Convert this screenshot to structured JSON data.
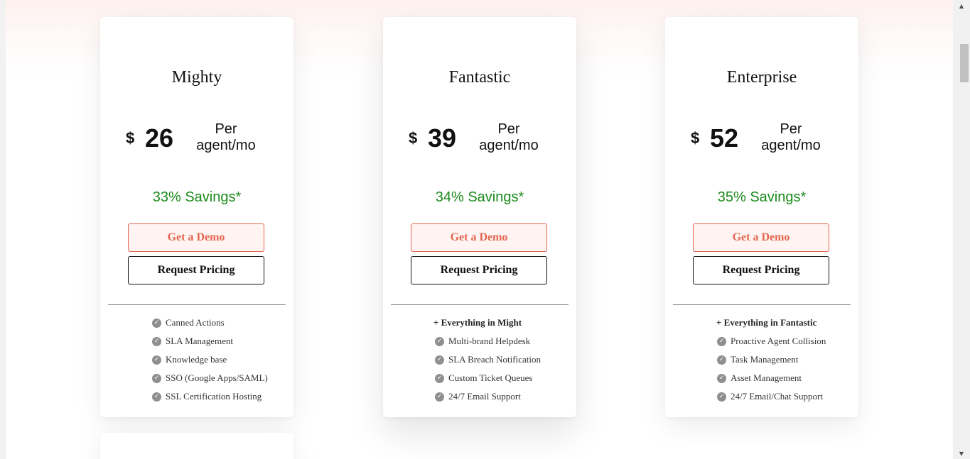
{
  "plans": [
    {
      "name": "Mighty",
      "currency": "$",
      "price": "26",
      "per_line1": "Per",
      "per_line2": "agent/mo",
      "savings": "33% Savings*",
      "demo_label": "Get a Demo",
      "pricing_label": "Request Pricing",
      "heading": "",
      "features": [
        "Canned Actions",
        "SLA Management",
        "Knowledge base",
        "SSO (Google Apps/SAML)",
        "SSL Certification Hosting"
      ]
    },
    {
      "name": "Fantastic",
      "currency": "$",
      "price": "39",
      "per_line1": "Per",
      "per_line2": "agent/mo",
      "savings": "34% Savings*",
      "demo_label": "Get a Demo",
      "pricing_label": "Request Pricing",
      "heading": "+ Everything in Might",
      "features": [
        "Multi-brand Helpdesk",
        "SLA Breach Notification",
        "Custom Ticket Queues",
        "24/7 Email Support"
      ]
    },
    {
      "name": "Enterprise",
      "currency": "$",
      "price": "52",
      "per_line1": "Per",
      "per_line2": "agent/mo",
      "savings": "35% Savings*",
      "demo_label": "Get a Demo",
      "pricing_label": "Request Pricing",
      "heading": "+ Everything in Fantastic",
      "features": [
        "Proactive Agent Collision",
        "Task Management",
        "Asset Management",
        "24/7 Email/Chat Support"
      ]
    }
  ],
  "icons": {
    "feature_check": "check-circle-icon",
    "scroll_up": "arrow-up-icon",
    "scroll_down": "arrow-down-icon"
  },
  "colors": {
    "demo_accent": "#e3654f",
    "savings_green": "#1a8a1a"
  }
}
